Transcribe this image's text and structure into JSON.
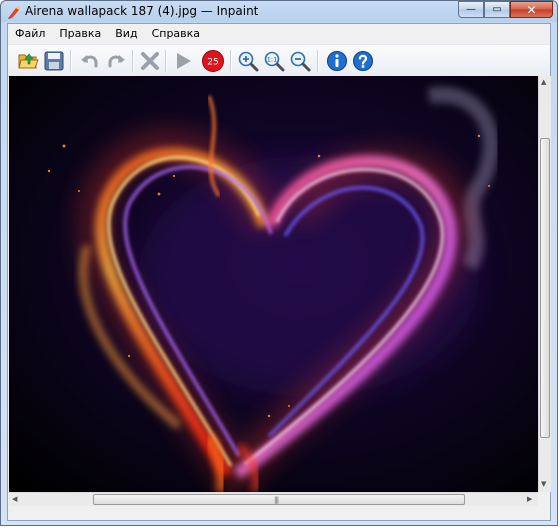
{
  "window": {
    "title": "Airena wallapack 187 (4).jpg — Inpaint"
  },
  "caption": {
    "minimize": "—",
    "maximize": "▭",
    "close": "✕"
  },
  "menu": [
    "Файл",
    "Правка",
    "Вид",
    "Справка"
  ],
  "toolbar": {
    "badge_count": "25",
    "zoom_actual_label": "1:1",
    "colors": {
      "badge": "#e0121b",
      "info": "#1e6fd1"
    }
  },
  "scrollbars": {
    "grip": "|||"
  }
}
